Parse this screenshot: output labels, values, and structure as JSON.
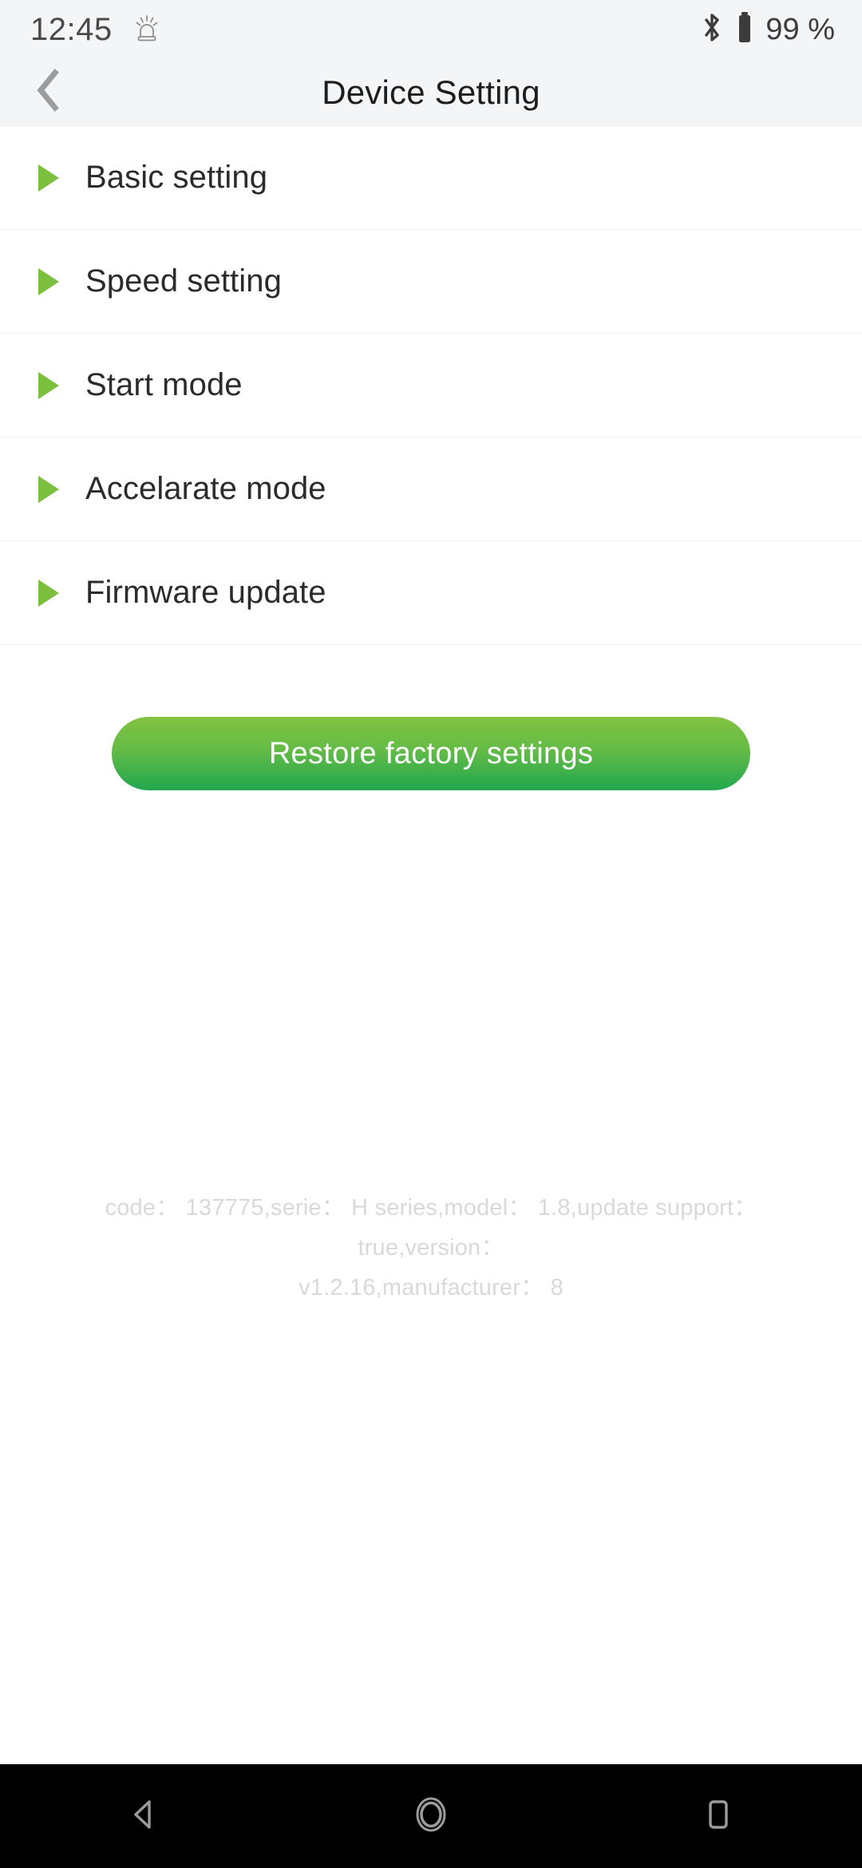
{
  "statusbar": {
    "time": "12:45",
    "alarm_icon": "alarm-beacon-icon",
    "bluetooth_icon": "bluetooth-icon",
    "battery_icon": "battery-full-icon",
    "battery_text": "99 %"
  },
  "appbar": {
    "back_icon": "chevron-left-icon",
    "title": "Device Setting"
  },
  "settings": {
    "bullet_icon": "triangle-right-icon",
    "items": [
      {
        "label": "Basic setting"
      },
      {
        "label": "Speed setting"
      },
      {
        "label": "Start mode"
      },
      {
        "label": "Accelarate mode"
      },
      {
        "label": "Firmware update"
      }
    ]
  },
  "actions": {
    "restore_label": "Restore factory settings"
  },
  "device_info": {
    "line1": "code： 137775,serie： H series,model： 1.8,update support： true,version：",
    "line2": "v1.2.16,manufacturer： 8"
  },
  "navbar": {
    "back_icon": "nav-back-triangle-icon",
    "home_icon": "nav-home-circle-icon",
    "recents_icon": "nav-recents-square-icon"
  },
  "colors": {
    "accent_green": "#7cbf3f",
    "button_gradient_top": "#83c341",
    "button_gradient_bottom": "#21a74f",
    "statusbar_bg": "#f4f5f6",
    "info_text": "#d7d9db"
  }
}
